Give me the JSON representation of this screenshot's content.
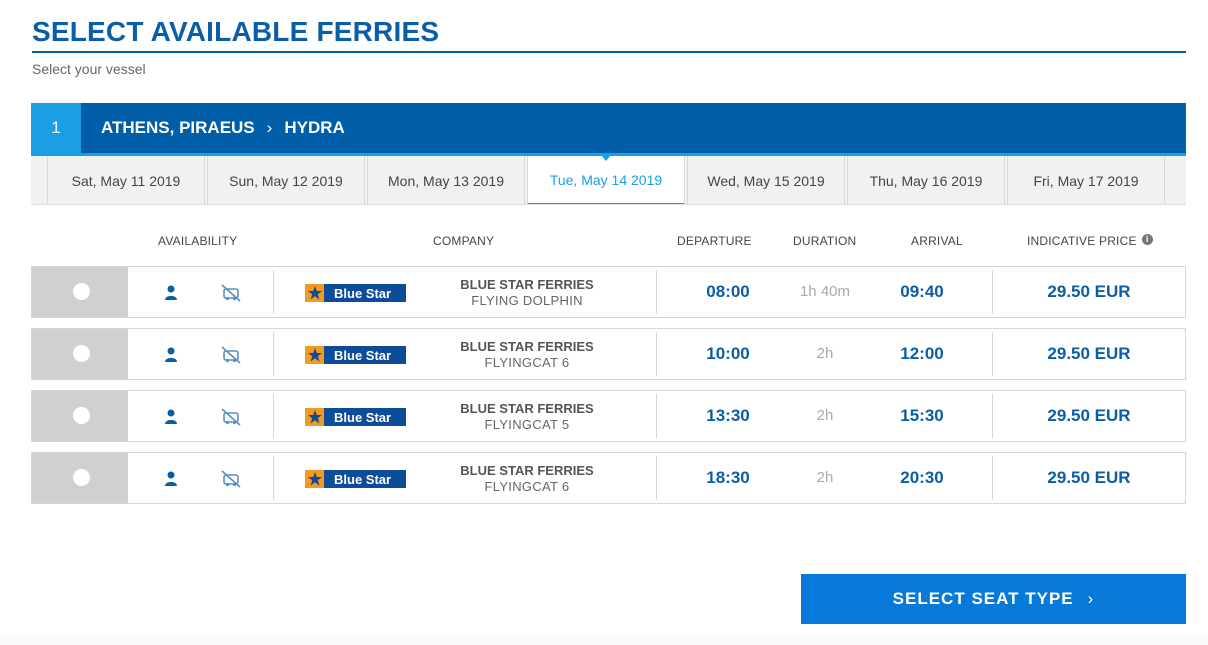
{
  "header": {
    "title": "SELECT AVAILABLE FERRIES",
    "subtitle": "Select your vessel"
  },
  "route": {
    "number": "1",
    "origin": "ATHENS, PIRAEUS",
    "separator": "›",
    "destination": "HYDRA"
  },
  "dates": [
    {
      "label": "Sat, May 11 2019",
      "active": false
    },
    {
      "label": "Sun, May 12 2019",
      "active": false
    },
    {
      "label": "Mon, May 13 2019",
      "active": false
    },
    {
      "label": "Tue, May 14 2019",
      "active": true
    },
    {
      "label": "Wed, May 15 2019",
      "active": false
    },
    {
      "label": "Thu, May 16 2019",
      "active": false
    },
    {
      "label": "Fri, May 17 2019",
      "active": false
    }
  ],
  "columns": {
    "availability": "AVAILABILITY",
    "company": "COMPANY",
    "departure": "DEPARTURE",
    "duration": "DURATION",
    "arrival": "ARRIVAL",
    "price": "INDICATIVE PRICE",
    "price_info_icon": "i"
  },
  "ferries": [
    {
      "company": "BLUE STAR FERRIES",
      "vessel": "FLYING DOLPHIN",
      "logo_text": "Blue Star",
      "departure": "08:00",
      "duration": "1h 40m",
      "arrival": "09:40",
      "price": "29.50 EUR"
    },
    {
      "company": "BLUE STAR FERRIES",
      "vessel": "FLYINGCAT 6",
      "logo_text": "Blue Star",
      "departure": "10:00",
      "duration": "2h",
      "arrival": "12:00",
      "price": "29.50 EUR"
    },
    {
      "company": "BLUE STAR FERRIES",
      "vessel": "FLYINGCAT 5",
      "logo_text": "Blue Star",
      "departure": "13:30",
      "duration": "2h",
      "arrival": "15:30",
      "price": "29.50 EUR"
    },
    {
      "company": "BLUE STAR FERRIES",
      "vessel": "FLYINGCAT 6",
      "logo_text": "Blue Star",
      "departure": "18:30",
      "duration": "2h",
      "arrival": "20:30",
      "price": "29.50 EUR"
    }
  ],
  "icons": {
    "passenger": "person-icon",
    "vehicle": "no-vehicle-icon",
    "logo_star": "star-icon"
  },
  "colors": {
    "primary": "#0a5ea8",
    "accent": "#1a9fe5",
    "button": "#0779d8",
    "logo_orange": "#f29a20"
  },
  "actions": {
    "select_seat_label": "SELECT SEAT TYPE",
    "select_seat_chevron": "›"
  }
}
